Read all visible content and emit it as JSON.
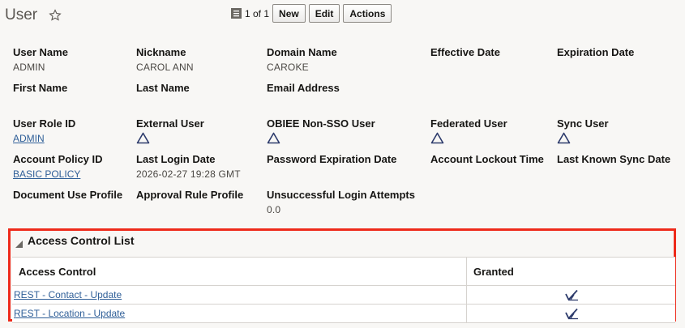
{
  "page": {
    "title": "User"
  },
  "toolbar": {
    "record_count": "1 of 1",
    "new_label": "New",
    "edit_label": "Edit",
    "actions_label": "Actions"
  },
  "fields": {
    "user_name": {
      "label": "User Name",
      "value": "ADMIN"
    },
    "nickname": {
      "label": "Nickname",
      "value": "CAROL ANN"
    },
    "domain_name": {
      "label": "Domain Name",
      "value": "CAROKE"
    },
    "effective_date": {
      "label": "Effective Date",
      "value": ""
    },
    "expiration_date": {
      "label": "Expiration Date",
      "value": ""
    },
    "first_name": {
      "label": "First Name",
      "value": ""
    },
    "last_name": {
      "label": "Last Name",
      "value": ""
    },
    "email_address": {
      "label": "Email Address",
      "value": ""
    },
    "user_role_id": {
      "label": "User Role ID",
      "value": "ADMIN"
    },
    "external_user": {
      "label": "External User",
      "icon": "triangle-icon"
    },
    "obiee_non_sso_user": {
      "label": "OBIEE Non-SSO User",
      "icon": "triangle-icon"
    },
    "federated_user": {
      "label": "Federated User",
      "icon": "triangle-icon"
    },
    "sync_user": {
      "label": "Sync User",
      "icon": "triangle-icon"
    },
    "account_policy_id": {
      "label": "Account Policy ID",
      "value": "BASIC POLICY"
    },
    "last_login_date": {
      "label": "Last Login Date",
      "value": "2026-02-27 19:28 GMT"
    },
    "password_expiration_date": {
      "label": "Password Expiration Date",
      "value": ""
    },
    "account_lockout_time": {
      "label": "Account Lockout Time",
      "value": ""
    },
    "last_known_sync_date": {
      "label": "Last Known Sync Date",
      "value": ""
    },
    "document_use_profile": {
      "label": "Document Use Profile",
      "value": ""
    },
    "approval_rule_profile": {
      "label": "Approval Rule Profile",
      "value": ""
    },
    "unsuccessful_login_attempts": {
      "label": "Unsuccessful Login Attempts",
      "value": "0.0"
    }
  },
  "acl": {
    "title": "Access Control List",
    "columns": {
      "access_control": "Access Control",
      "granted": "Granted"
    },
    "rows": [
      {
        "access_control": "REST - Contact - Update",
        "granted_icon": "checkmark-icon"
      },
      {
        "access_control": "REST - Location - Update",
        "granted_icon": "checkmark-icon"
      }
    ]
  },
  "colors": {
    "link": "#2f5f98",
    "highlight": "#ee2a1a",
    "icon": "#2c3a6b"
  }
}
